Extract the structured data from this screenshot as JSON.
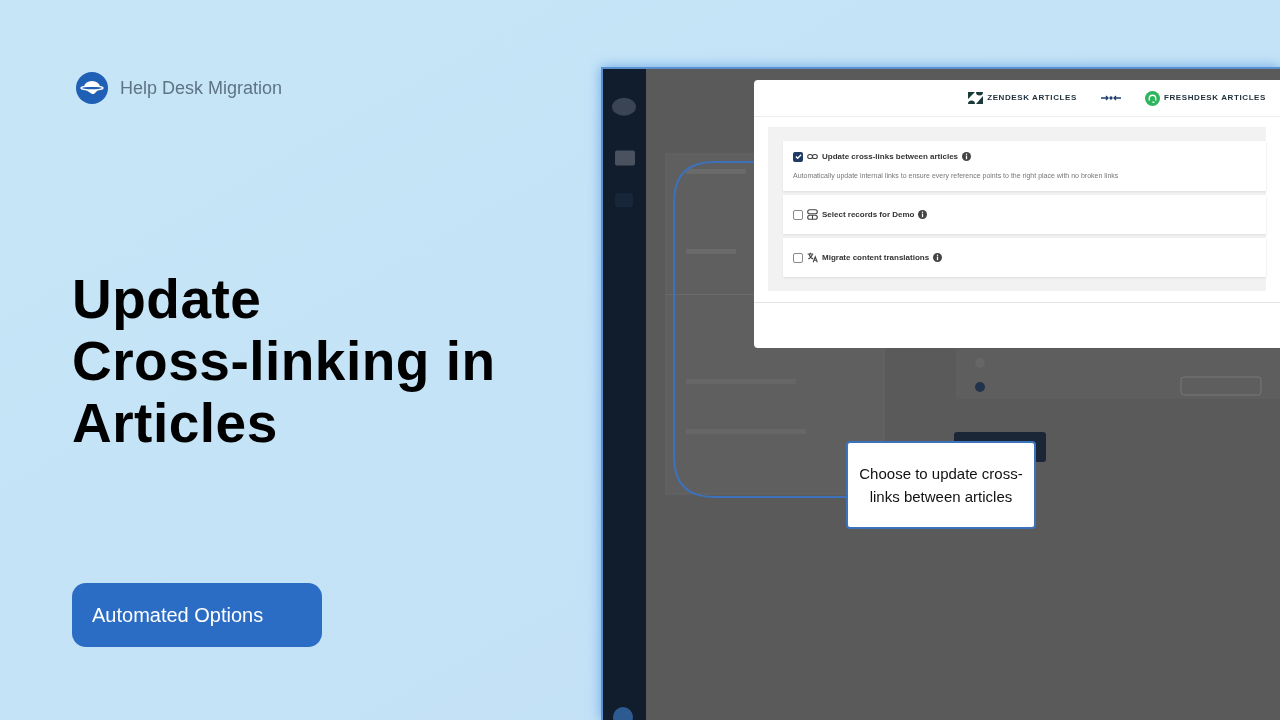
{
  "brand": {
    "name": "Help Desk Migration"
  },
  "headline_lines": [
    "Update",
    "Cross-linking in",
    "Articles"
  ],
  "tag_button": "Automated Options",
  "modal": {
    "source": "ZENDESK ARTICLES",
    "target": "FRESHDESK ARTICLES",
    "options": [
      {
        "kind": "link",
        "label": "Update cross-links between articles",
        "description": "Automatically update internal links to ensure every reference points to the right place with no broken links",
        "checked": true
      },
      {
        "kind": "records",
        "label": "Select records for Demo",
        "checked": false
      },
      {
        "kind": "translate",
        "label": "Migrate content translations",
        "checked": false
      }
    ]
  },
  "callout": {
    "text": "Choose to update cross-links between articles"
  }
}
